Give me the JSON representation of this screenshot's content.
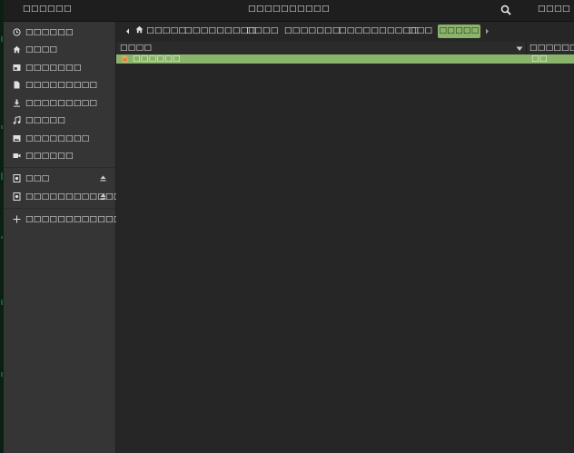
{
  "header": {
    "app_menu": "□□□□□□",
    "title": "□□□□□□□□□□",
    "menu": "□□□□"
  },
  "sidebar": {
    "items": [
      {
        "label": "□□□□□□",
        "icon": "clock-icon"
      },
      {
        "label": "□□□□",
        "icon": "home-icon"
      },
      {
        "label": "□□□□□□□",
        "icon": "desktop-icon"
      },
      {
        "label": "□□□□□□□□□",
        "icon": "document-icon"
      },
      {
        "label": "□□□□□□□□□",
        "icon": "download-icon"
      },
      {
        "label": "□□□□□",
        "icon": "music-icon"
      },
      {
        "label": "□□□□□□□□",
        "icon": "pictures-icon"
      },
      {
        "label": "□□□□□□",
        "icon": "video-icon"
      }
    ],
    "devices": [
      {
        "label": "□□□",
        "icon": "drive-icon"
      },
      {
        "label": "□□□□□□□□□□□□",
        "icon": "drive-icon"
      }
    ],
    "other": {
      "label": "□□□□□□□□□□□□□□□□",
      "icon": "plus-icon"
    }
  },
  "pathbar": {
    "crumbs": [
      "□□□□□",
      "□□□□□□□□□",
      "□□□□",
      "□□□□□□□",
      "□□□□□□□□□□",
      "□□□",
      "□□□□□"
    ],
    "active_index": 6
  },
  "list": {
    "columns": {
      "name": "□□□□",
      "modified": "□□□□□□□□□"
    },
    "rows": [
      {
        "name": "□□□□□□",
        "modified": "□□ □□□"
      }
    ]
  },
  "colors": {
    "accent": "#8ab46b",
    "sidebar_bg": "#353535",
    "content_bg": "#262626",
    "header_bg": "#1e1e1e"
  }
}
